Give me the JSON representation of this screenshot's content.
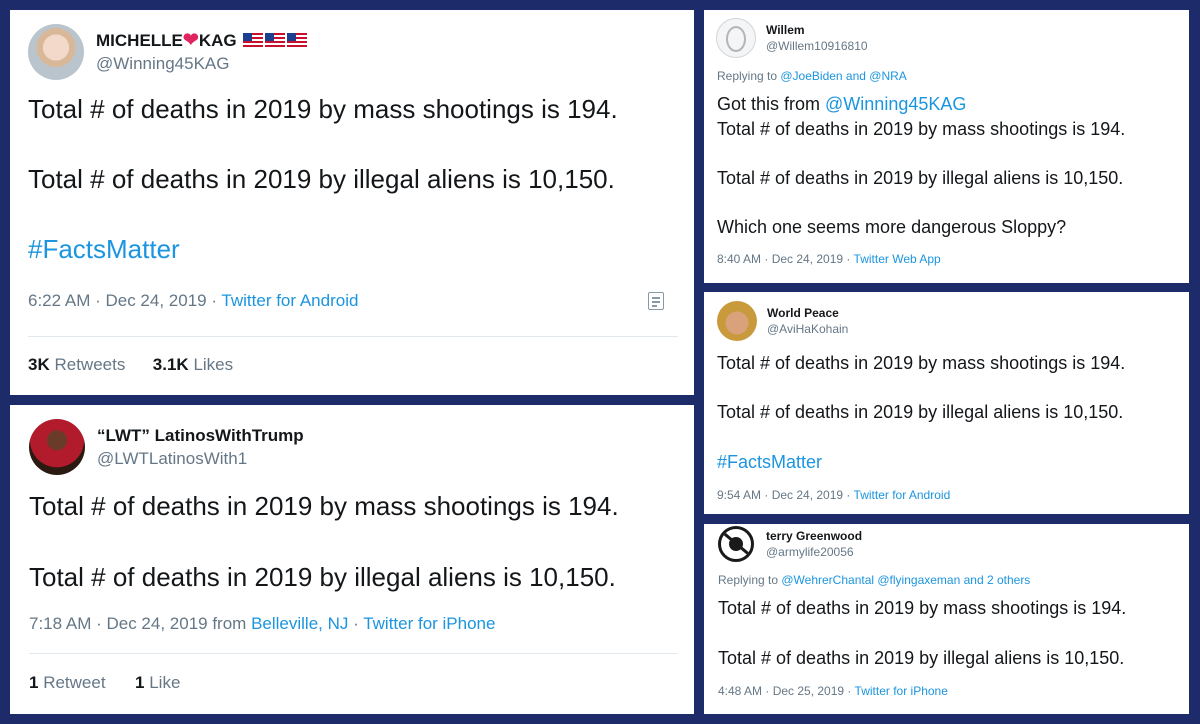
{
  "tweets": [
    {
      "name": "MICHELLE",
      "name_suffix": "KAG",
      "heart": "❤",
      "handle": "@Winning45KAG",
      "line1": "Total # of deaths in 2019 by mass shootings is 194.",
      "line2": "Total # of deaths in 2019 by illegal aliens is 10,150.",
      "hashtag": "#FactsMatter",
      "time": "6:22 AM · Dec 24, 2019 · ",
      "source": "Twitter for Android",
      "retweets_count": "3K",
      "retweets_label": " Retweets",
      "likes_count": "3.1K",
      "likes_label": " Likes"
    },
    {
      "name": "“LWT” LatinosWithTrump",
      "handle": "@LWTLatinosWith1",
      "line1": "Total # of deaths in 2019 by mass shootings is 194.",
      "line2": "Total # of deaths in 2019 by illegal aliens is 10,150.",
      "time": "7:18 AM · Dec 24, 2019 from ",
      "location": "Belleville, NJ",
      "dot": " · ",
      "source": "Twitter for iPhone",
      "retweets_count": "1",
      "retweets_label": " Retweet",
      "likes_count": "1",
      "likes_label": " Like"
    },
    {
      "name": "Willem",
      "handle": "@Willem10916810",
      "reply_prefix": "Replying to ",
      "reply_to": "@JoeBiden and @NRA",
      "intro": "Got this from ",
      "intro_link": "@Winning45KAG",
      "line1": "Total # of deaths in 2019 by mass shootings is 194.",
      "line2": "Total # of deaths in 2019 by illegal aliens is 10,150.",
      "line3": "Which one seems more dangerous Sloppy?",
      "time": "8:40 AM · Dec 24, 2019 · ",
      "source": "Twitter Web App"
    },
    {
      "name": "World Peace",
      "handle": "@AviHaKohain",
      "line1": "Total # of deaths in 2019 by mass shootings is 194.",
      "line2": "Total # of deaths in 2019 by illegal aliens is 10,150.",
      "hashtag": "#FactsMatter",
      "time": "9:54 AM · Dec 24, 2019 · ",
      "source": "Twitter for Android"
    },
    {
      "name": "terry Greenwood",
      "handle": "@armylife20056",
      "reply_prefix": "Replying to ",
      "reply_to": "@WehrerChantal @flyingaxeman and 2 others",
      "line1": "Total # of deaths in 2019 by mass shootings is 194.",
      "line2": "Total # of deaths in 2019 by illegal aliens is 10,150.",
      "time": "4:48 AM · Dec 25, 2019 · ",
      "source": "Twitter for iPhone"
    }
  ],
  "colors": {
    "background": "#1d2b6b",
    "link": "#1b95e0",
    "text": "#14171a",
    "muted": "#657786"
  }
}
